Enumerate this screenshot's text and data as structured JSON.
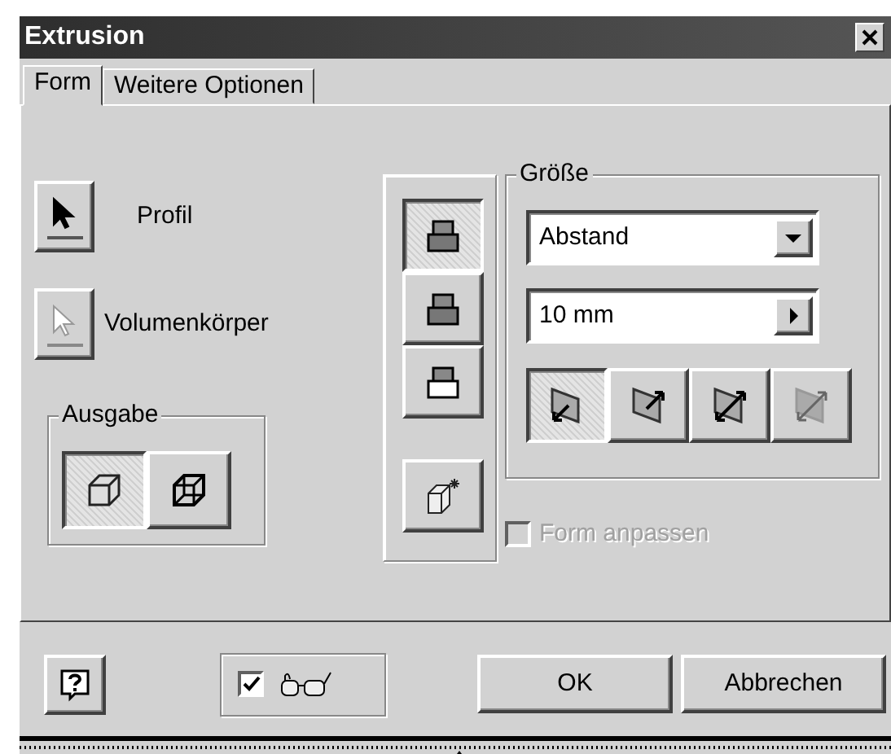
{
  "window": {
    "title": "Extrusion"
  },
  "tabs": [
    {
      "label": "Form",
      "selected": true
    },
    {
      "label": "Weitere Optionen",
      "selected": false
    }
  ],
  "selectors": [
    {
      "label": "Profil",
      "disabled": false
    },
    {
      "label": "Volumenkörper",
      "disabled": true
    }
  ],
  "output": {
    "label": "Ausgabe",
    "options": [
      {
        "kind": "solid",
        "selected": true
      },
      {
        "kind": "surface",
        "selected": false
      }
    ]
  },
  "directions": [
    {
      "kind": "first",
      "selected": true
    },
    {
      "kind": "second",
      "selected": false
    },
    {
      "kind": "symmetric",
      "selected": false
    }
  ],
  "size": {
    "label": "Größe",
    "mode": "Abstand",
    "distance": "10 mm",
    "extents": [
      {
        "kind": "first",
        "selected": true
      },
      {
        "kind": "second",
        "selected": false
      },
      {
        "kind": "both",
        "selected": false
      },
      {
        "kind": "asymmetric",
        "selected": false
      }
    ]
  },
  "match_shape": {
    "label": "Form anpassen",
    "checked": false,
    "disabled": true
  },
  "footer": {
    "preview_checked": true,
    "buttons": [
      "OK",
      "Abbrechen"
    ]
  }
}
